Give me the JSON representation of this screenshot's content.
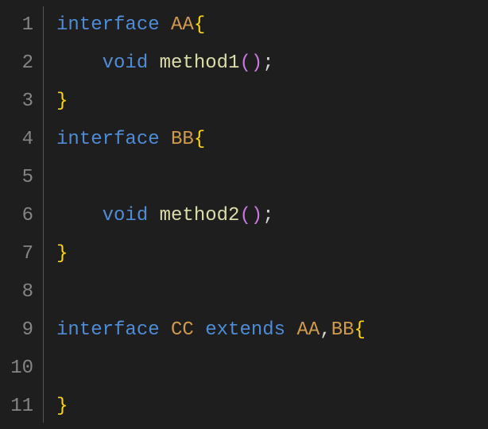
{
  "editor": {
    "lines": [
      {
        "num": "1",
        "tokens": [
          {
            "cls": "keyword",
            "text": "interface "
          },
          {
            "cls": "type-name",
            "text": "AA"
          },
          {
            "cls": "bracket-yellow",
            "text": "{"
          }
        ]
      },
      {
        "num": "2",
        "tokens": [
          {
            "cls": "",
            "text": "    "
          },
          {
            "cls": "keyword",
            "text": "void "
          },
          {
            "cls": "method-name",
            "text": "method1"
          },
          {
            "cls": "bracket-purple",
            "text": "()"
          },
          {
            "cls": "punct",
            "text": ";"
          }
        ]
      },
      {
        "num": "3",
        "tokens": [
          {
            "cls": "bracket-yellow",
            "text": "}"
          }
        ]
      },
      {
        "num": "4",
        "tokens": [
          {
            "cls": "keyword",
            "text": "interface "
          },
          {
            "cls": "type-name",
            "text": "BB"
          },
          {
            "cls": "bracket-yellow",
            "text": "{"
          }
        ]
      },
      {
        "num": "5",
        "tokens": []
      },
      {
        "num": "6",
        "tokens": [
          {
            "cls": "",
            "text": "    "
          },
          {
            "cls": "keyword",
            "text": "void "
          },
          {
            "cls": "method-name",
            "text": "method2"
          },
          {
            "cls": "bracket-purple",
            "text": "()"
          },
          {
            "cls": "punct",
            "text": ";"
          }
        ]
      },
      {
        "num": "7",
        "tokens": [
          {
            "cls": "bracket-yellow",
            "text": "}"
          }
        ]
      },
      {
        "num": "8",
        "tokens": []
      },
      {
        "num": "9",
        "tokens": [
          {
            "cls": "keyword",
            "text": "interface "
          },
          {
            "cls": "type-name",
            "text": "CC "
          },
          {
            "cls": "keyword",
            "text": "extends "
          },
          {
            "cls": "type-name",
            "text": "AA"
          },
          {
            "cls": "punct",
            "text": ","
          },
          {
            "cls": "type-name",
            "text": "BB"
          },
          {
            "cls": "bracket-yellow",
            "text": "{"
          }
        ]
      },
      {
        "num": "10",
        "tokens": []
      },
      {
        "num": "11",
        "tokens": [
          {
            "cls": "bracket-yellow",
            "text": "}"
          }
        ]
      }
    ]
  }
}
